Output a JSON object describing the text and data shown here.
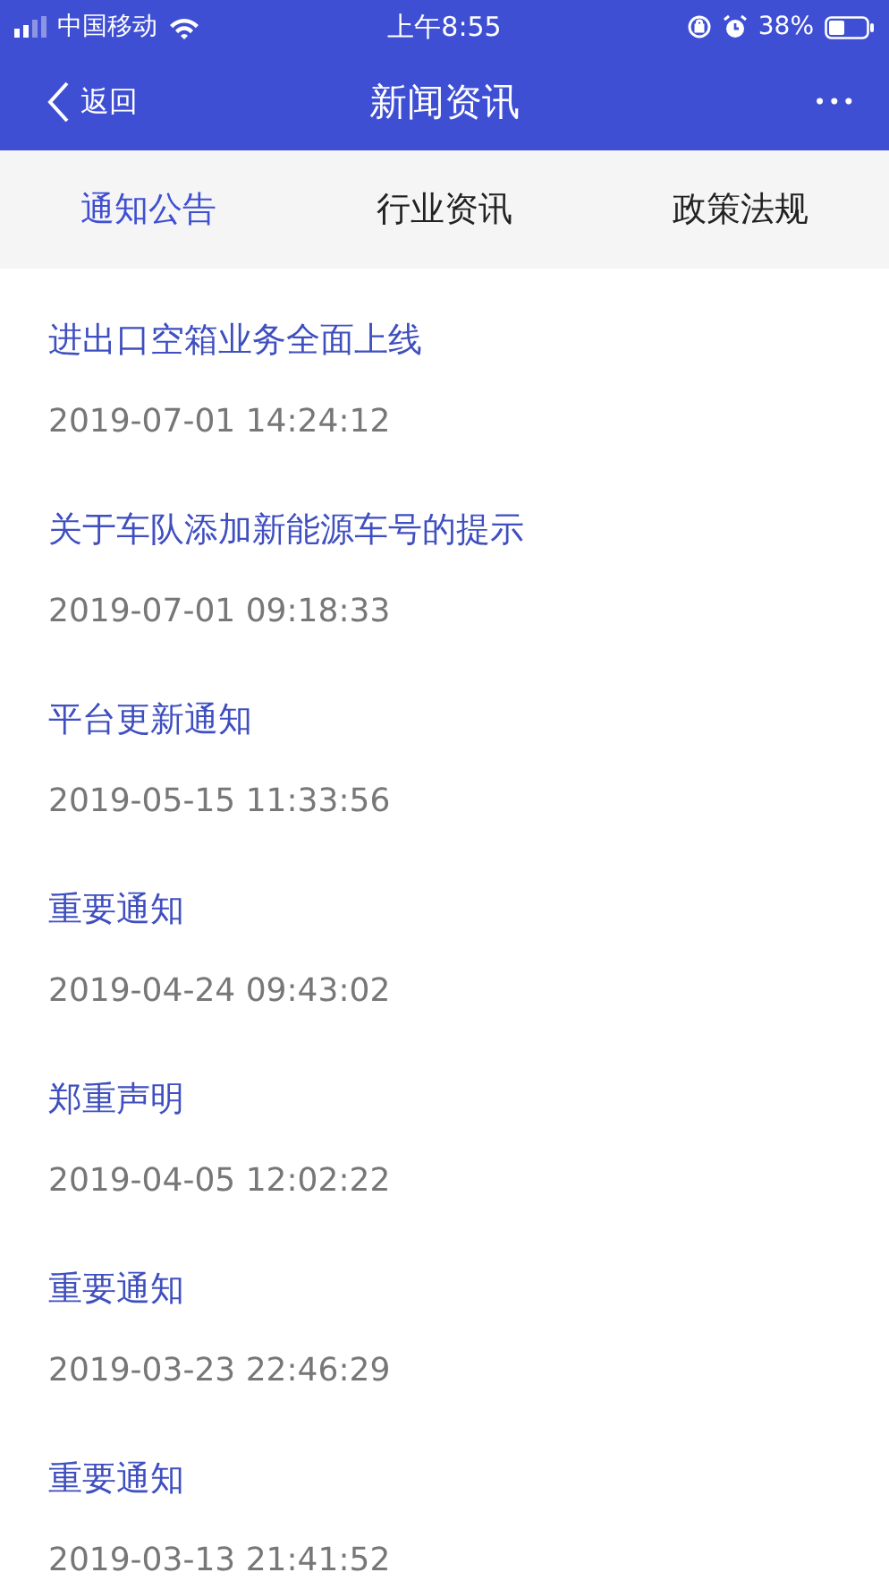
{
  "status_bar": {
    "carrier": "中国移动",
    "time": "上午8:55",
    "battery": "38%"
  },
  "header": {
    "back": "返回",
    "title": "新闻资讯",
    "more": "•••"
  },
  "tabs": [
    {
      "label": "通知公告",
      "selected": true
    },
    {
      "label": "行业资讯",
      "selected": false
    },
    {
      "label": "政策法规",
      "selected": false
    }
  ],
  "news": [
    {
      "title": "进出口空箱业务全面上线",
      "time": "2019-07-01 14:24:12"
    },
    {
      "title": "关于车队添加新能源车号的提示",
      "time": "2019-07-01 09:18:33"
    },
    {
      "title": "平台更新通知",
      "time": "2019-05-15 11:33:56"
    },
    {
      "title": "重要通知",
      "time": "2019-04-24 09:43:02"
    },
    {
      "title": "郑重声明",
      "time": "2019-04-05 12:02:22"
    },
    {
      "title": "重要通知",
      "time": "2019-03-23 22:46:29"
    },
    {
      "title": "重要通知",
      "time": "2019-03-13 21:41:52"
    }
  ]
}
